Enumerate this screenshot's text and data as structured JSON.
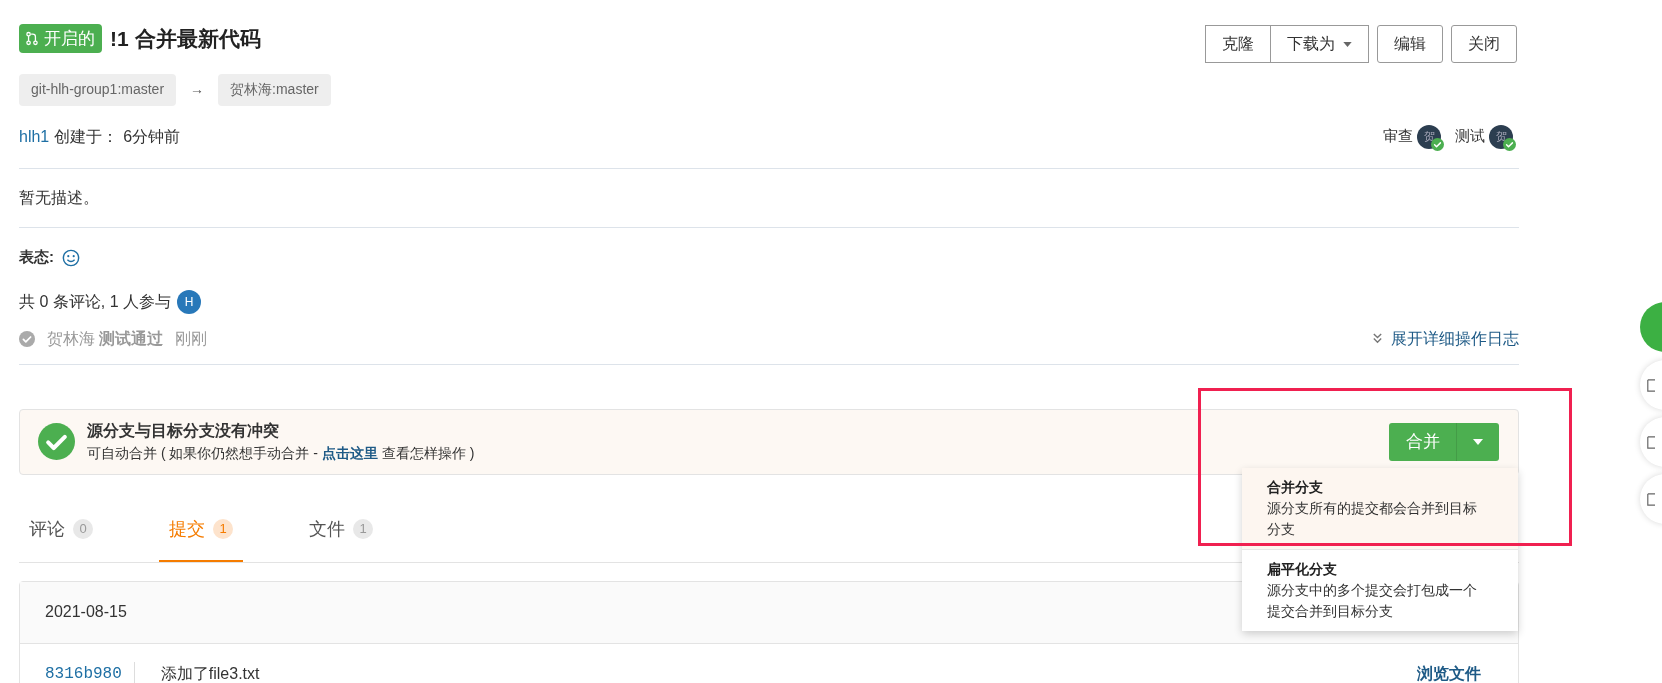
{
  "header": {
    "status_badge": "开启的",
    "title": "!1 合并最新代码",
    "button_group": [
      {
        "label": "克隆",
        "kind": "plain"
      },
      {
        "label": "下载为",
        "kind": "dropdown"
      }
    ],
    "buttons": [
      {
        "label": "编辑"
      },
      {
        "label": "关闭"
      }
    ]
  },
  "branches": {
    "source": "git-hlh-group1:master",
    "arrow": "→",
    "target": "贺林海:master"
  },
  "author": {
    "name": "hlh1",
    "created_label": "创建于：",
    "time": "6分钟前"
  },
  "reviewers": [
    {
      "role": "审查",
      "avatar": "贺",
      "approved": true
    },
    {
      "role": "测试",
      "avatar": "贺",
      "approved": true
    }
  ],
  "description": "暂无描述。",
  "reactions_label": "表态:",
  "comments_summary": "共 0 条评论, 1 人参与",
  "participants": [
    {
      "initial": "H"
    }
  ],
  "activity": {
    "user": "贺林海",
    "action": "测试通过",
    "time": "刚刚"
  },
  "expand_log": "展开详细操作日志",
  "merge_status": {
    "title": "源分支与目标分支没有冲突",
    "text": "可自动合并 ( 如果你仍然想手动合并 - ",
    "link": "点击这里",
    "text_after": " 查看怎样操作 )",
    "merge_button": "合并"
  },
  "merge_menu": [
    {
      "title": "合并分支",
      "description": "源分支所有的提交都会合并到目标分支",
      "selected": true
    },
    {
      "title": "扁平化分支",
      "description": "源分支中的多个提交会打包成一个提交合并到目标分支",
      "selected": false
    }
  ],
  "tabs": [
    {
      "label": "评论",
      "count": "0",
      "selected": false
    },
    {
      "label": "提交",
      "count": "1",
      "selected": true
    },
    {
      "label": "文件",
      "count": "1",
      "selected": false
    }
  ],
  "commits": {
    "date": "2021-08-15",
    "rows": [
      {
        "sha": "8316b980",
        "message": "添加了file3.txt",
        "browse": "浏览文件"
      }
    ]
  }
}
